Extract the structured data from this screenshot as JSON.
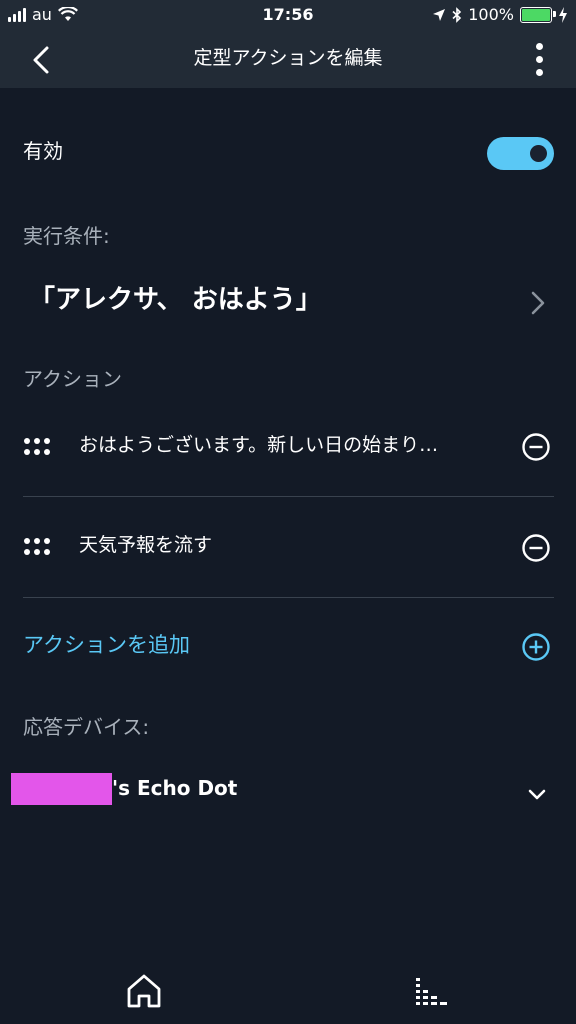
{
  "status": {
    "carrier": "au",
    "time": "17:56",
    "battery": "100%",
    "battery_level": 1.0
  },
  "nav": {
    "title": "定型アクションを編集",
    "back_icon": "chevron-left-icon",
    "more_icon": "more-vertical-icon"
  },
  "enabled": {
    "label": "有効",
    "value": true
  },
  "trigger": {
    "section_label": "実行条件:",
    "phrase": "「アレクサ、 おはよう」"
  },
  "actions": {
    "section_label": "アクション",
    "items": [
      {
        "text": "おはようございます。新しい日の始まり…"
      },
      {
        "text": "天気予報を流す"
      }
    ],
    "add_label": "アクションを追加"
  },
  "device": {
    "section_label": "応答デバイス:",
    "name": "'s Echo Dot"
  },
  "tabs": {
    "home_icon": "home-icon",
    "activity_icon": "activity-icon"
  },
  "colors": {
    "background": "#131a26",
    "header": "#222b36",
    "accent": "#5ac8f5",
    "redaction": "#e356ea"
  }
}
